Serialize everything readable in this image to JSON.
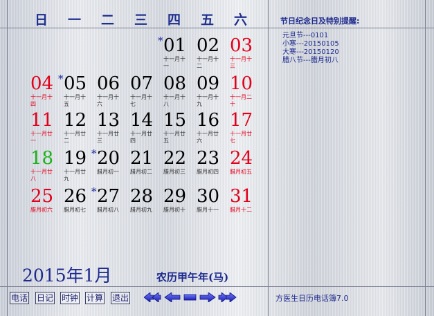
{
  "weekdays": [
    "日",
    "一",
    "二",
    "三",
    "四",
    "五",
    "六"
  ],
  "calendar": {
    "rows": [
      [
        null,
        null,
        null,
        null,
        {
          "day": "01",
          "lunar": "十一月十一",
          "star": true,
          "color": "normal"
        },
        {
          "day": "02",
          "lunar": "十一月十二",
          "star": false,
          "color": "normal"
        },
        {
          "day": "03",
          "lunar": "十一月十三",
          "star": false,
          "color": "red"
        }
      ],
      [
        {
          "day": "04",
          "lunar": "十一月十四",
          "star": false,
          "color": "red"
        },
        {
          "day": "05",
          "lunar": "十一月十五",
          "star": true,
          "color": "normal"
        },
        {
          "day": "06",
          "lunar": "十一月十六",
          "star": false,
          "color": "normal"
        },
        {
          "day": "07",
          "lunar": "十一月十七",
          "star": false,
          "color": "normal"
        },
        {
          "day": "08",
          "lunar": "十一月十八",
          "star": false,
          "color": "normal"
        },
        {
          "day": "09",
          "lunar": "十一月十九",
          "star": false,
          "color": "normal"
        },
        {
          "day": "10",
          "lunar": "十一月二十",
          "star": false,
          "color": "red"
        }
      ],
      [
        {
          "day": "11",
          "lunar": "十一月廿一",
          "star": false,
          "color": "red"
        },
        {
          "day": "12",
          "lunar": "十一月廿二",
          "star": false,
          "color": "normal"
        },
        {
          "day": "13",
          "lunar": "十一月廿三",
          "star": false,
          "color": "normal"
        },
        {
          "day": "14",
          "lunar": "十一月廿四",
          "star": false,
          "color": "normal"
        },
        {
          "day": "15",
          "lunar": "十一月廿五",
          "star": false,
          "color": "normal"
        },
        {
          "day": "16",
          "lunar": "十一月廿六",
          "star": false,
          "color": "normal"
        },
        {
          "day": "17",
          "lunar": "十一月廿七",
          "star": false,
          "color": "red"
        }
      ],
      [
        {
          "day": "18",
          "lunar": "十一月廿八",
          "star": false,
          "color": "green"
        },
        {
          "day": "19",
          "lunar": "十一月廿九",
          "star": false,
          "color": "normal"
        },
        {
          "day": "20",
          "lunar": "腊月初一",
          "star": true,
          "color": "normal"
        },
        {
          "day": "21",
          "lunar": "腊月初二",
          "star": false,
          "color": "normal"
        },
        {
          "day": "22",
          "lunar": "腊月初三",
          "star": false,
          "color": "normal"
        },
        {
          "day": "23",
          "lunar": "腊月初四",
          "star": false,
          "color": "normal"
        },
        {
          "day": "24",
          "lunar": "腊月初五",
          "star": false,
          "color": "red"
        }
      ],
      [
        {
          "day": "25",
          "lunar": "腊月初六",
          "star": false,
          "color": "red"
        },
        {
          "day": "26",
          "lunar": "腊月初七",
          "star": false,
          "color": "normal"
        },
        {
          "day": "27",
          "lunar": "腊月初八",
          "star": true,
          "color": "normal"
        },
        {
          "day": "28",
          "lunar": "腊月初九",
          "star": false,
          "color": "normal"
        },
        {
          "day": "29",
          "lunar": "腊月初十",
          "star": false,
          "color": "normal"
        },
        {
          "day": "30",
          "lunar": "腊月十一",
          "star": false,
          "color": "normal"
        },
        {
          "day": "31",
          "lunar": "腊月十二",
          "star": false,
          "color": "red"
        }
      ]
    ]
  },
  "panel": {
    "title": "节日纪念日及特别提醒:",
    "reminders": [
      "元旦节---0101",
      "小寒---20150105",
      "大寒---20150120",
      "腊八节---腊月初八"
    ]
  },
  "footer": {
    "month_label": "2015年1月",
    "lunar_year": "农历甲午年(马)",
    "buttons": [
      "电话",
      "日记",
      "时钟",
      "计算",
      "退出"
    ],
    "nav": [
      "first",
      "prev",
      "today",
      "next",
      "last"
    ],
    "version": "方医生日历电话簿7.0"
  },
  "colors": {
    "normal": "#000000",
    "red": "#e2001a",
    "green": "#19b319",
    "accent": "#1d2a8e",
    "star": "#1c2aa0"
  }
}
